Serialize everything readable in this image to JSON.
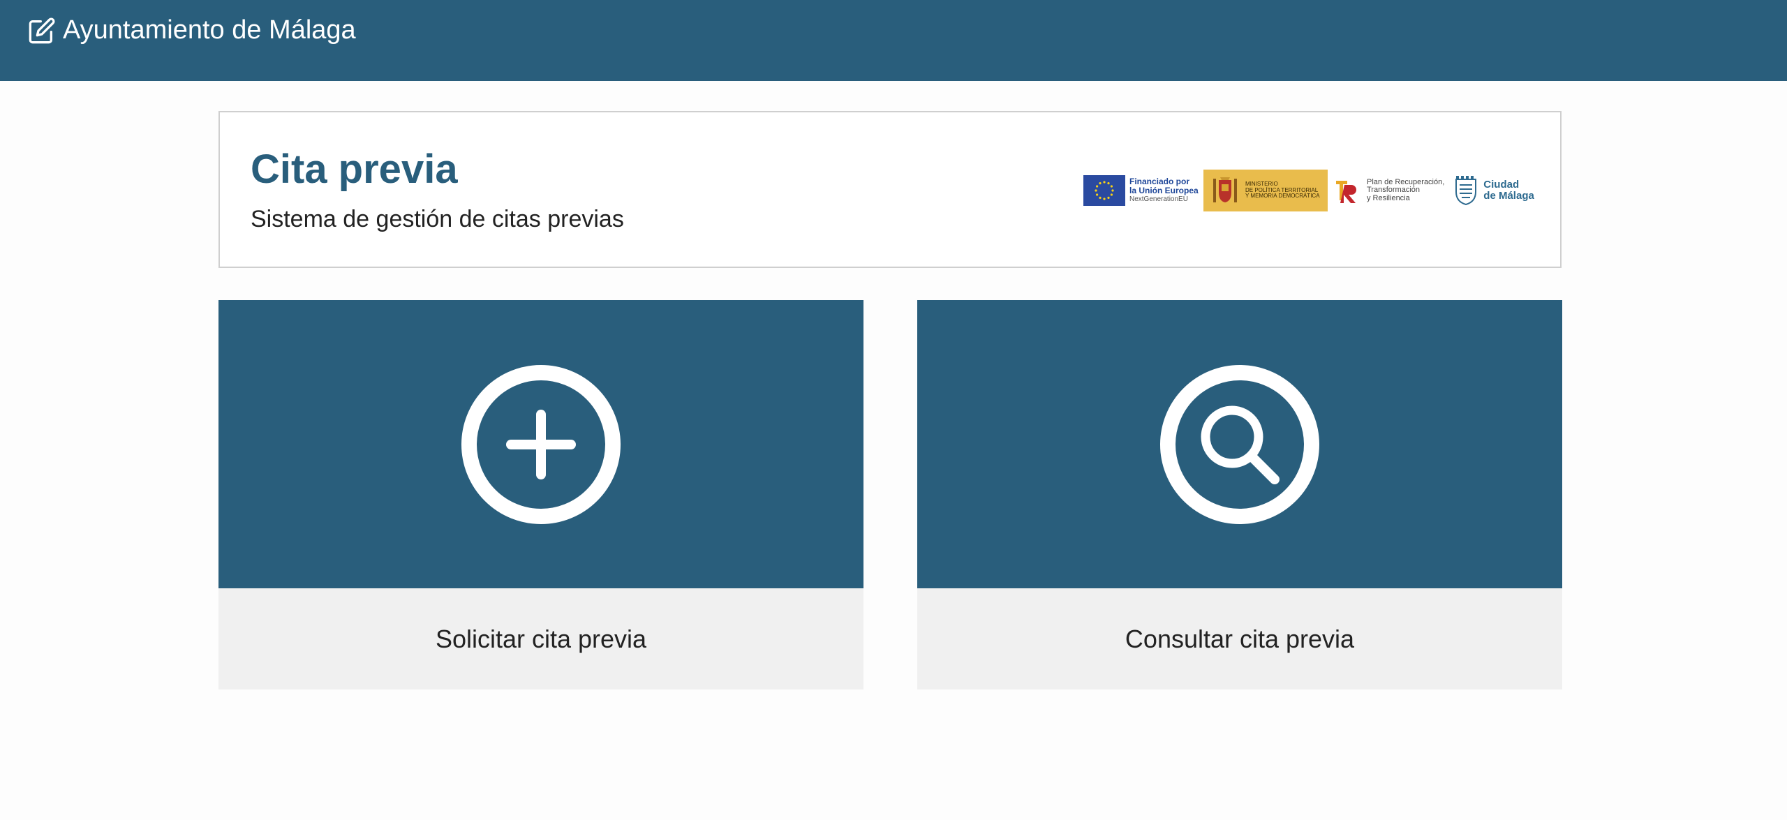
{
  "header": {
    "title": "Ayuntamiento de Málaga",
    "icon": "edit-icon",
    "background": "#295e7c"
  },
  "intro": {
    "title": "Cita previa",
    "subtitle": "Sistema de gestión de citas previas",
    "title_color": "#295e7c"
  },
  "logos": {
    "eu": {
      "line1": "Financiado por",
      "line2": "la Unión Europea",
      "line3": "NextGenerationEU"
    },
    "ministerio": {
      "line1": "MINISTERIO",
      "line2": "DE POLÍTICA TERRITORIAL",
      "line3": "Y MEMORIA DEMOCRÁTICA"
    },
    "plan": {
      "line1": "Plan de Recuperación,",
      "line2": "Transformación",
      "line3": "y Resiliencia"
    },
    "city": {
      "line1": "Ciudad",
      "line2": "de Málaga"
    }
  },
  "options": [
    {
      "label": "Solicitar cita previa",
      "icon": "plus-circle-icon"
    },
    {
      "label": "Consultar cita previa",
      "icon": "search-circle-icon"
    }
  ],
  "colors": {
    "accent": "#295e7c",
    "card_footer": "#f0f0f0"
  }
}
